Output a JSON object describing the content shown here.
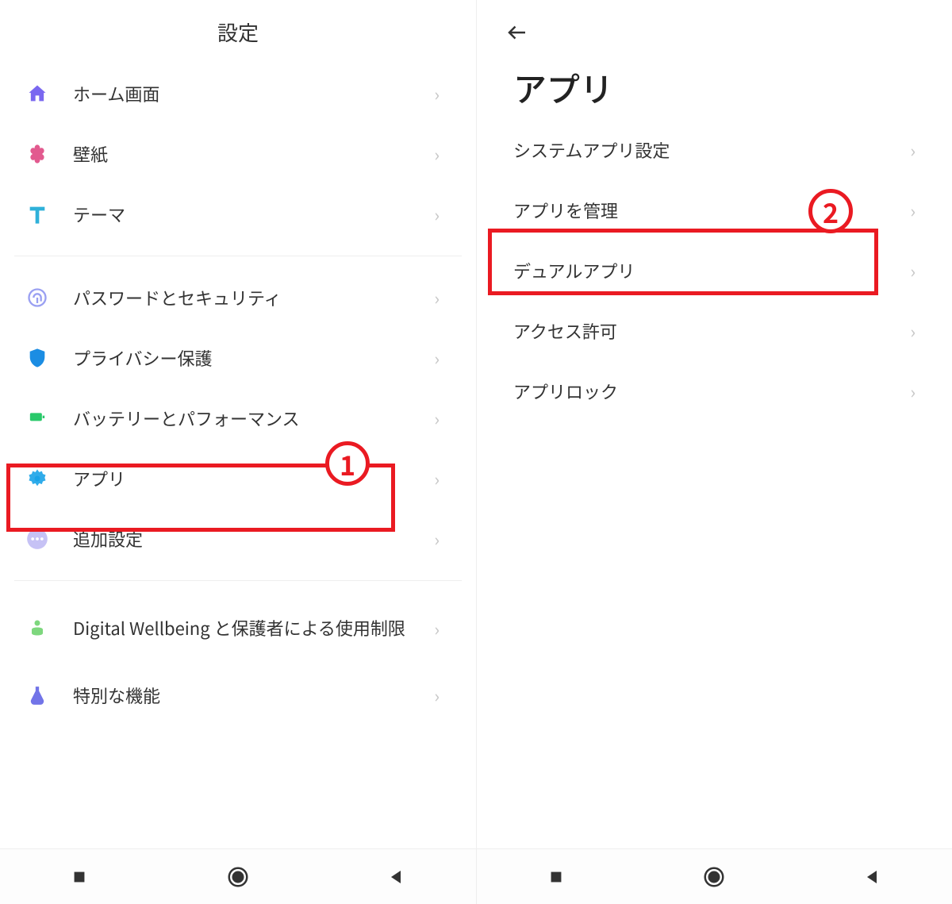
{
  "left": {
    "title": "設定",
    "groups": [
      [
        "ホーム画面",
        "壁紙",
        "テーマ"
      ],
      [
        "パスワードとセキュリティ",
        "プライバシー保護",
        "バッテリーとパフォーマンス",
        "アプリ",
        "追加設定"
      ],
      [
        "Digital Wellbeing と保護者による使用制限",
        "特別な機能"
      ]
    ]
  },
  "right": {
    "title": "アプリ",
    "items": [
      "システムアプリ設定",
      "アプリを管理",
      "デュアルアプリ",
      "アクセス許可",
      "アプリロック"
    ]
  },
  "annotations": {
    "badge1": "1",
    "badge2": "2"
  },
  "colors": {
    "highlight": "#ea1a22"
  }
}
